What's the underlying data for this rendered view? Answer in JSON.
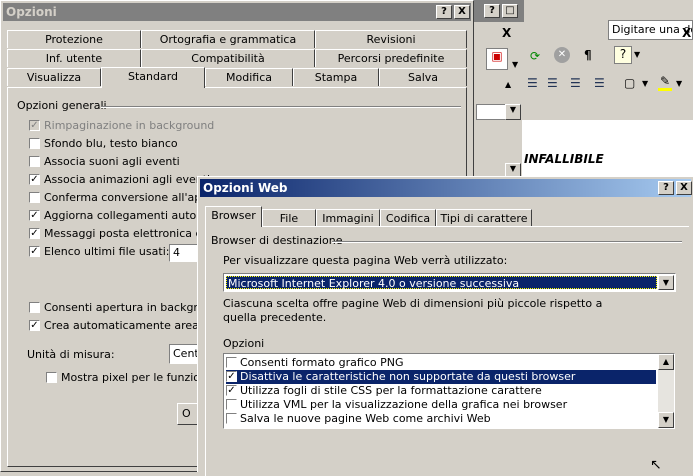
{
  "word_bg": {
    "search_placeholder": "Digitare una don",
    "doc_text": "INFALLIBILE",
    "mini_dialog_buttons": [
      "?",
      "X"
    ],
    "x_icon": "X"
  },
  "opzioni": {
    "title": "Opzioni",
    "title_buttons": [
      "?",
      "X"
    ],
    "tabs_row1": [
      "Protezione",
      "Ortografia e grammatica",
      "Revisioni"
    ],
    "tabs_row2": [
      "Inf. utente",
      "Compatibilità",
      "Percorsi predefinite"
    ],
    "tabs_row3": [
      "Visualizza",
      "Standard",
      "Modifica",
      "Stampa",
      "Salva"
    ],
    "section": "Opzioni generali",
    "options": [
      {
        "label": "Rimpaginazione in background",
        "checked": true,
        "disabled": true
      },
      {
        "label": "Sfondo blu, testo bianco",
        "checked": false
      },
      {
        "label": "Associa suoni agli eventi",
        "checked": false
      },
      {
        "label": "Associa animazioni agli eventi",
        "checked": true
      },
      {
        "label": "Conferma conversione all'apert",
        "checked": false
      },
      {
        "label": "Aggiorna collegamenti automat",
        "checked": true
      },
      {
        "label": "Messaggi posta elettronica com",
        "checked": true
      },
      {
        "label": "Elenco ultimi file usati:",
        "checked": true
      }
    ],
    "recent_files_value": "4",
    "options2": [
      {
        "label": "Consenti apertura in backgrou",
        "checked": false
      },
      {
        "label": "Crea automaticamente area di",
        "checked": true
      }
    ],
    "units_label": "Unità di misura:",
    "units_value": "Cent",
    "pixel_label": "Mostra pixel per le funziona",
    "ok_partial": "O"
  },
  "web": {
    "title": "Opzioni Web",
    "title_buttons": [
      "?",
      "X"
    ],
    "tabs": [
      "Browser",
      "File",
      "Immagini",
      "Codifica",
      "Tipi di carattere"
    ],
    "group1": "Browser di destinazione",
    "prompt": "Per visualizzare questa pagina Web verrà utilizzato:",
    "browser_value": "Microsoft Internet Explorer 4.0 o versione successiva",
    "description": "Ciascuna scelta offre pagine Web di dimensioni più piccole rispetto a quella precedente.",
    "group2": "Opzioni",
    "options": [
      {
        "label": "Consenti formato grafico PNG",
        "checked": false,
        "selected": false
      },
      {
        "label": "Disattiva le caratteristiche non supportate da questi browser",
        "checked": true,
        "selected": true
      },
      {
        "label": "Utilizza fogli di stile CSS per la formattazione carattere",
        "checked": true,
        "selected": false
      },
      {
        "label": "Utilizza VML per la visualizzazione della grafica nei browser",
        "checked": false,
        "selected": false
      },
      {
        "label": "Salva le nuove pagine Web come archivi Web",
        "checked": false,
        "selected": false
      }
    ]
  }
}
